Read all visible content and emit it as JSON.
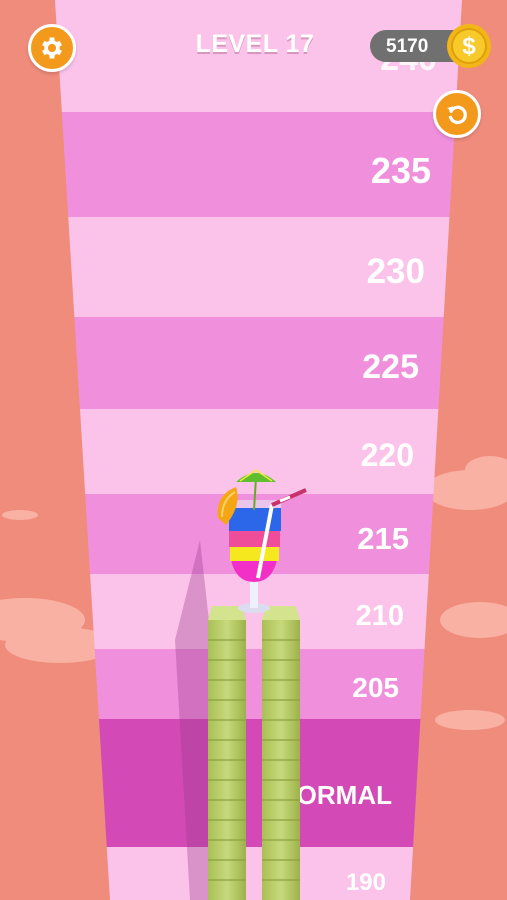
{
  "hud": {
    "level_title": "LEVEL 17",
    "coins": "5170",
    "settings_icon": "gear-icon",
    "restart_icon": "restart-icon",
    "coin_icon": "dollar-coin-icon",
    "accent_color": "#f39a1c"
  },
  "track": {
    "markers": [
      "240",
      "235",
      "230",
      "225",
      "220",
      "215",
      "210",
      "205",
      "NORMAL",
      "190"
    ]
  },
  "colors": {
    "background": "#f08c7c",
    "band_light": "#fbc3ea",
    "band_mid": "#f090dc",
    "band_dark": "#d34ab7",
    "money_stack": "#b7cc6b"
  }
}
